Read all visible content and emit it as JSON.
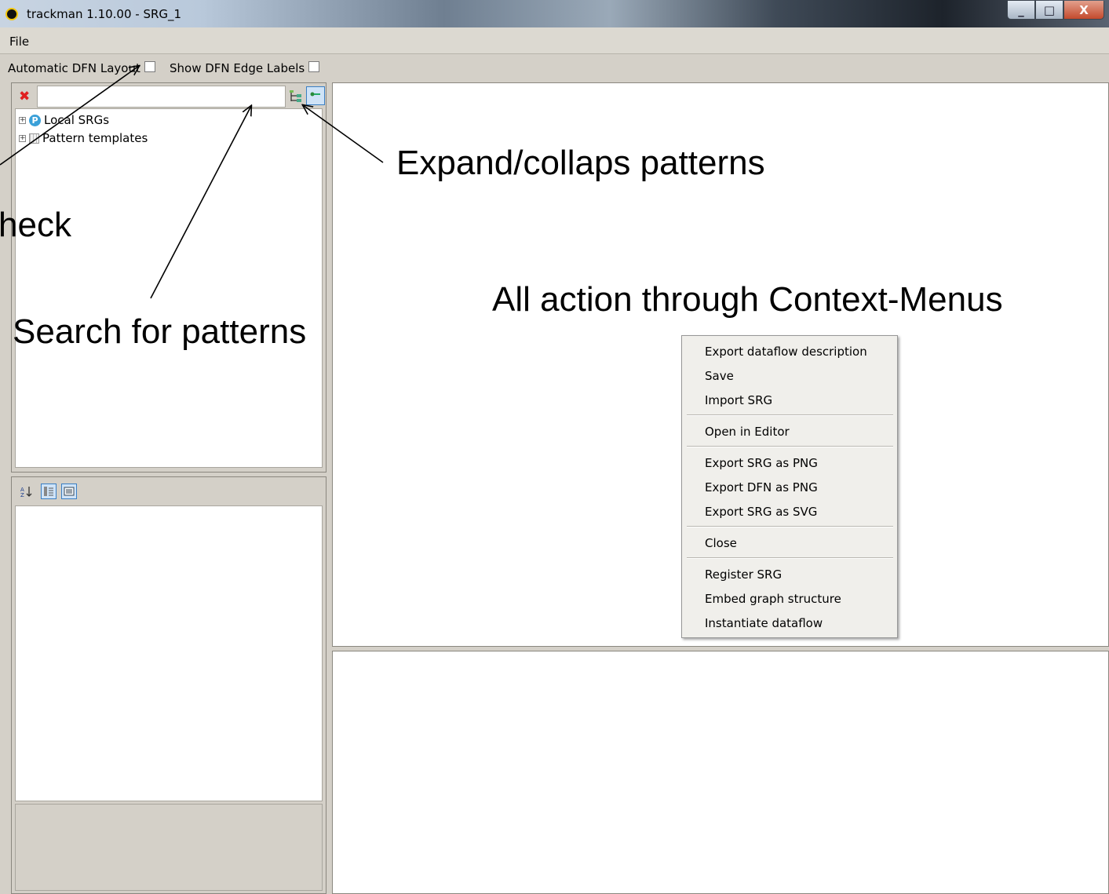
{
  "window": {
    "title": "trackman 1.10.00 - SRG_1",
    "controls": [
      "_",
      "□",
      "X"
    ]
  },
  "menubar": {
    "file": "File"
  },
  "toolbar": {
    "auto_layout_label": "Automatic DFN Layout",
    "edge_labels_label": "Show DFN Edge Labels"
  },
  "search": {
    "value": ""
  },
  "tree": {
    "items": [
      {
        "label": "Local SRGs",
        "icon": "p-circle-icon"
      },
      {
        "label": "Pattern templates",
        "icon": "grid-icon"
      }
    ]
  },
  "context_menu": {
    "groups": [
      [
        "Export dataflow description",
        "Save",
        "Import SRG"
      ],
      [
        "Open in Editor"
      ],
      [
        "Export SRG as PNG",
        "Export DFN as PNG",
        "Export SRG as SVG"
      ],
      [
        "Close"
      ],
      [
        "Register SRG",
        "Embed graph structure",
        "Instantiate dataflow"
      ]
    ]
  },
  "annotations": {
    "expand": "Expand/collaps patterns",
    "check": "heck",
    "search": "Search for patterns",
    "context": "All action through Context-Menus"
  }
}
